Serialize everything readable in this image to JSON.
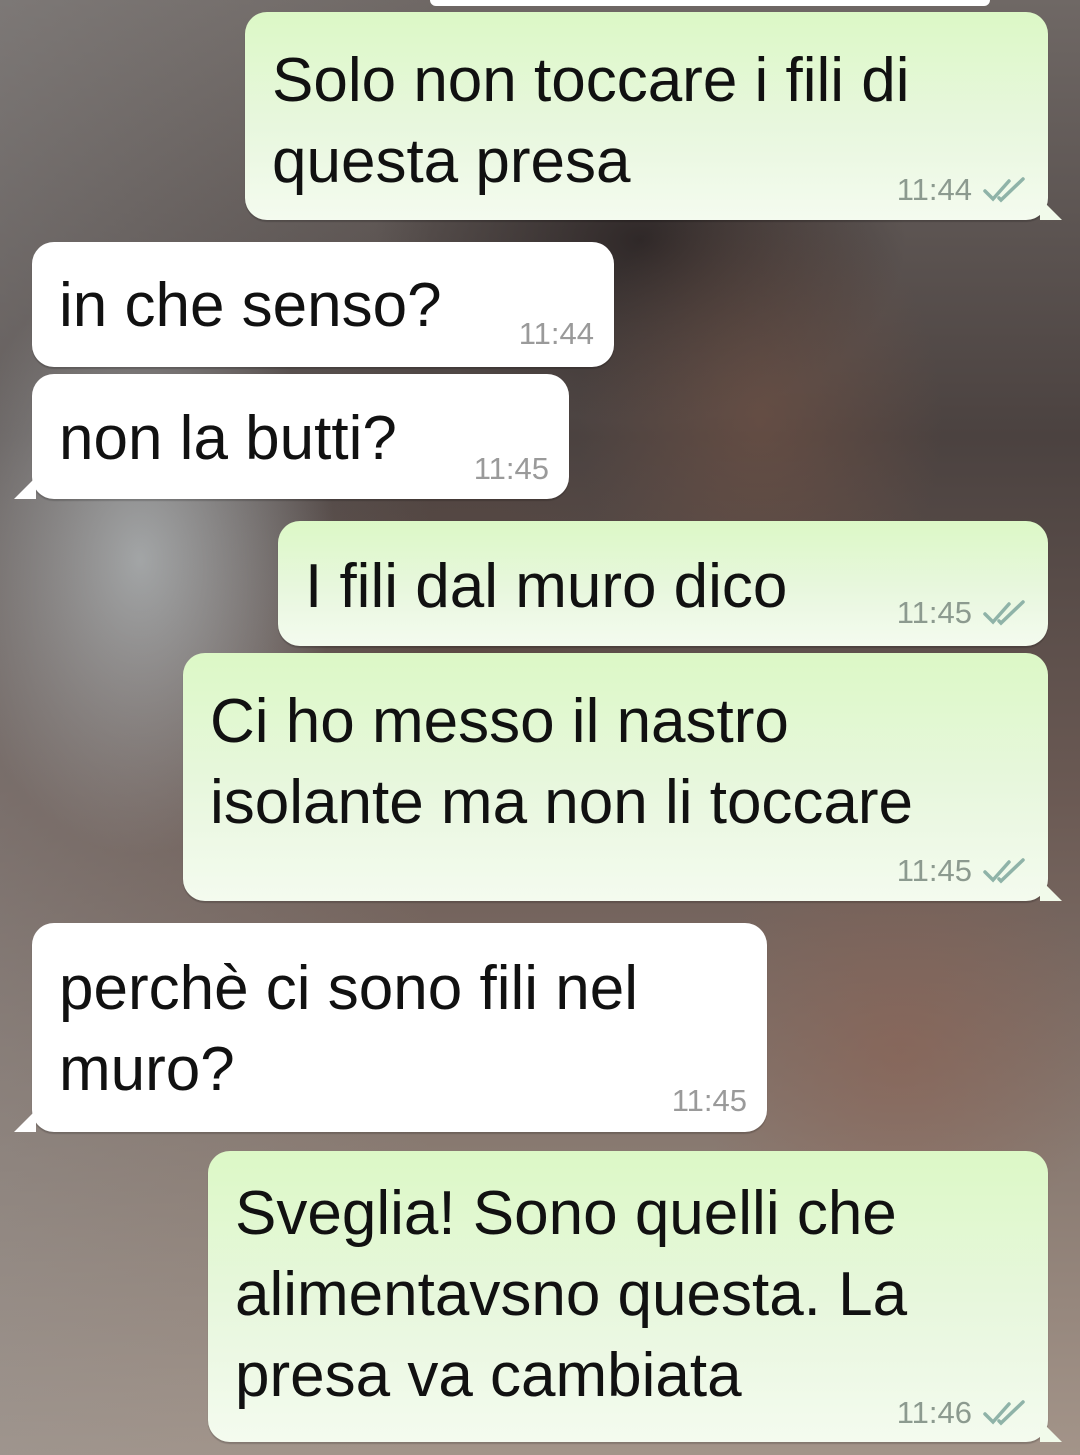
{
  "theme": {
    "outgoing_bubble": "#dcf8c6",
    "incoming_bubble": "#ffffff",
    "text_color": "#111111",
    "tick_color": "#4fc3f7"
  },
  "messages": [
    {
      "direction": "outgoing",
      "text": "Solo non toccare i fili di\nquesta presa",
      "time": "11:44",
      "status": "read"
    },
    {
      "direction": "incoming",
      "text": "in che senso?",
      "time": "11:44"
    },
    {
      "direction": "incoming",
      "text": "non la butti?",
      "time": "11:45"
    },
    {
      "direction": "outgoing",
      "text": "I fili dal muro dico",
      "time": "11:45",
      "status": "read"
    },
    {
      "direction": "outgoing",
      "text": "Ci ho messo il nastro\nisolante ma non li toccare",
      "time": "11:45",
      "status": "read"
    },
    {
      "direction": "incoming",
      "text": "perchè ci sono fili nel\nmuro?",
      "time": "11:45"
    },
    {
      "direction": "outgoing",
      "text": "Sveglia! Sono quelli che\nalimentavsno questa. La\npresa va cambiata",
      "time": "11:46",
      "status": "read"
    }
  ]
}
